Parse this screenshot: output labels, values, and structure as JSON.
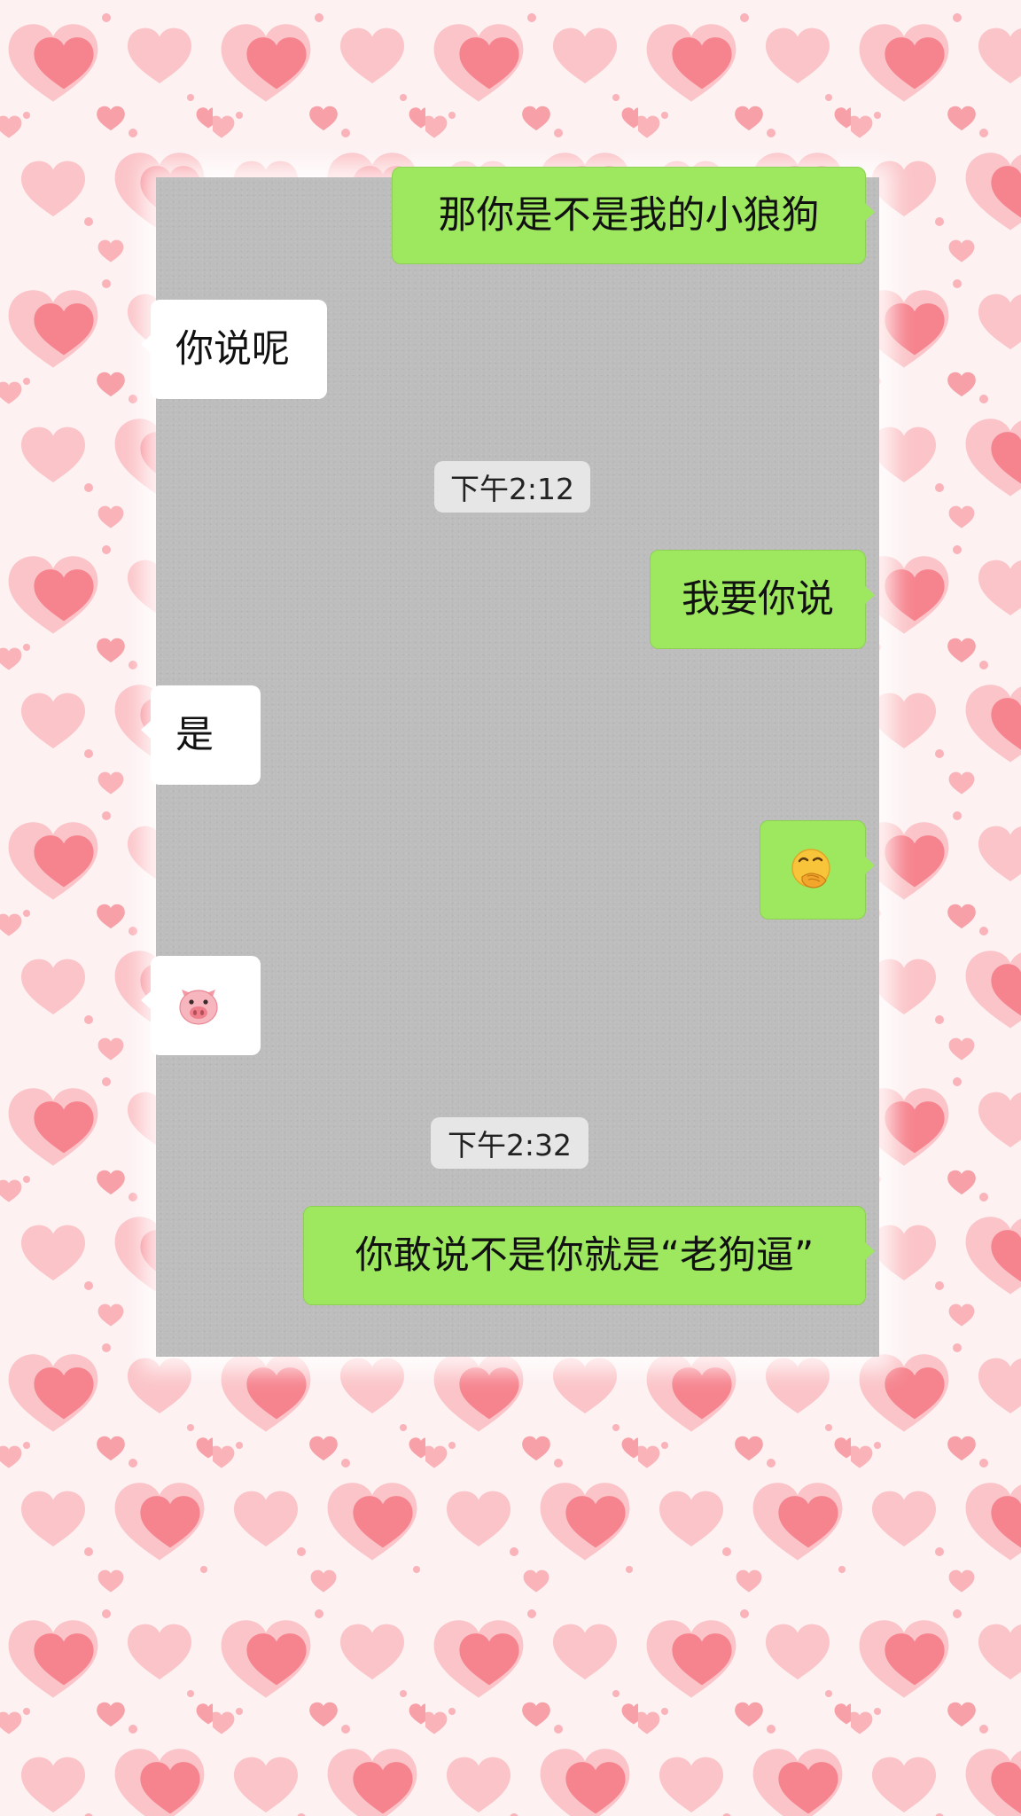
{
  "conversation": {
    "messages": [
      {
        "side": "outgoing",
        "text": "那你是不是我的小狼狗"
      },
      {
        "side": "incoming",
        "text": "你说呢"
      },
      {
        "type": "timestamp",
        "text": "下午2:12"
      },
      {
        "side": "outgoing",
        "text": "我要你说"
      },
      {
        "side": "incoming",
        "text": "是"
      },
      {
        "side": "outgoing",
        "emoji": "hand-over-mouth-emoji"
      },
      {
        "side": "incoming",
        "emoji": "pig-face-emoji"
      },
      {
        "type": "timestamp",
        "text": "下午2:32"
      },
      {
        "side": "outgoing",
        "text": "你敢说不是你就是“老狗逼”"
      }
    ]
  },
  "colors": {
    "outgoing_bubble": "#9de85f",
    "incoming_bubble": "#ffffff",
    "timestamp_bg": "#e6e6e6",
    "chat_background": "#bdbdbd",
    "wallpaper_heart_light": "#fbc4c8",
    "wallpaper_heart_dark": "#f6848e"
  }
}
